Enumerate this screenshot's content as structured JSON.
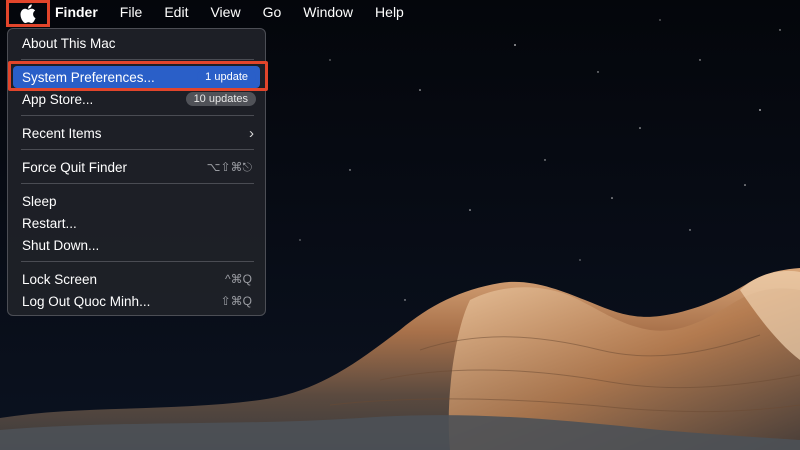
{
  "menubar": {
    "apple_icon": "apple-logo-icon",
    "items": [
      "Finder",
      "File",
      "Edit",
      "View",
      "Go",
      "Window",
      "Help"
    ]
  },
  "apple_menu": {
    "about": "About This Mac",
    "system_preferences": {
      "label": "System Preferences...",
      "badge": "1 update"
    },
    "app_store": {
      "label": "App Store...",
      "badge": "10 updates"
    },
    "recent_items": {
      "label": "Recent Items",
      "icon": "chevron-right-icon"
    },
    "force_quit": {
      "label": "Force Quit Finder",
      "shortcut": "⌥⇧⌘⎋"
    },
    "sleep": "Sleep",
    "restart": "Restart...",
    "shut_down": "Shut Down...",
    "lock_screen": {
      "label": "Lock Screen",
      "shortcut": "^⌘Q"
    },
    "log_out": {
      "label": "Log Out Quoc Minh...",
      "shortcut": "⇧⌘Q"
    }
  },
  "colors": {
    "highlight_outline": "#e2452b",
    "selection_blue": "#2a5fc8",
    "menu_background": "#202228"
  }
}
